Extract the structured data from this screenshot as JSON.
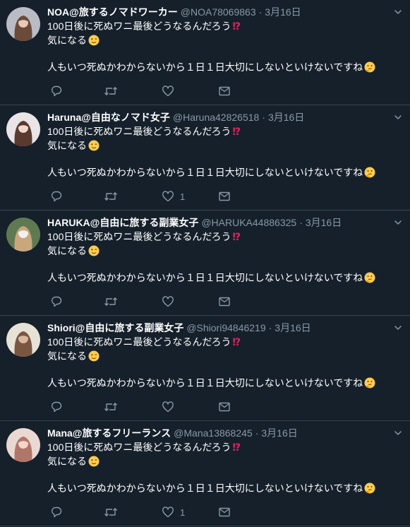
{
  "tweets": [
    {
      "name": "NOA@旅するノマドワーカー",
      "handle": "@NOA78069863",
      "date": "3月16日",
      "line1": "100日後に死ぬワニ最後どうなるんだろう",
      "line2": "気になる",
      "line3": "人もいつ死ぬかわからないから１日１日大切にしないといけないですね",
      "reply_count": "",
      "retweet_count": "",
      "like_count": "",
      "avatar_colors": {
        "bg": "#b9bcc4",
        "hair": "#6b4a3a",
        "skin": "#e8c9b5"
      }
    },
    {
      "name": "Haruna@自由なノマド女子",
      "handle": "@Haruna42826518",
      "date": "3月16日",
      "line1": "100日後に死ぬワニ最後どうなるんだろう",
      "line2": "気になる",
      "line3": "人もいつ死ぬかわからないから１日１日大切にしないといけないですね",
      "reply_count": "",
      "retweet_count": "",
      "like_count": "1",
      "avatar_colors": {
        "bg": "#e9e4e6",
        "hair": "#5a3a2e",
        "skin": "#f1d8cc"
      }
    },
    {
      "name": "HARUKA@自由に旅する副業女子",
      "handle": "@HARUKA44886325",
      "date": "3月16日",
      "line1": "100日後に死ぬワニ最後どうなるんだろう",
      "line2": "気になる",
      "line3": "人もいつ死ぬかわからないから１日１日大切にしないといけないですね",
      "reply_count": "",
      "retweet_count": "",
      "like_count": "",
      "avatar_colors": {
        "bg": "#5f7a52",
        "hair": "#c9a77a",
        "skin": "#f3f0f3"
      }
    },
    {
      "name": "Shiori@自由に旅する副業女子",
      "handle": "@Shiori94846219",
      "date": "3月16日",
      "line1": "100日後に死ぬワニ最後どうなるんだろう",
      "line2": "気になる",
      "line3": "人もいつ死ぬかわからないから１日１日大切にしないといけないですね",
      "reply_count": "",
      "retweet_count": "",
      "like_count": "",
      "avatar_colors": {
        "bg": "#e7e2d6",
        "hair": "#7a5640",
        "skin": "#d9b8a2"
      }
    },
    {
      "name": "Mana@旅するフリーランス",
      "handle": "@Mana13868245",
      "date": "3月16日",
      "line1": "100日後に死ぬワニ最後どうなるんだろう",
      "line2": "気になる",
      "line3": "人もいつ死ぬかわからないから１日１日大切にしないといけないですね",
      "reply_count": "",
      "retweet_count": "",
      "like_count": "1",
      "avatar_colors": {
        "bg": "#ead8d2",
        "hair": "#b0766a",
        "skin": "#f3d6c8"
      }
    }
  ],
  "icons": {
    "line1_emoji": "double-exclamation-question-icon",
    "line2_emoji": "winking-face-icon",
    "line3_emoji": "thinking-face-icon",
    "reply": "reply-icon",
    "retweet": "retweet-icon",
    "like": "heart-icon",
    "dm": "envelope-icon",
    "more": "chevron-down-icon"
  },
  "colors": {
    "background": "#15202b",
    "divider": "#38444d",
    "secondary_text": "#8899a6",
    "primary_text": "#ffffff",
    "emoji_red": "#e0245e",
    "emoji_yellow": "#ffcc4d"
  }
}
